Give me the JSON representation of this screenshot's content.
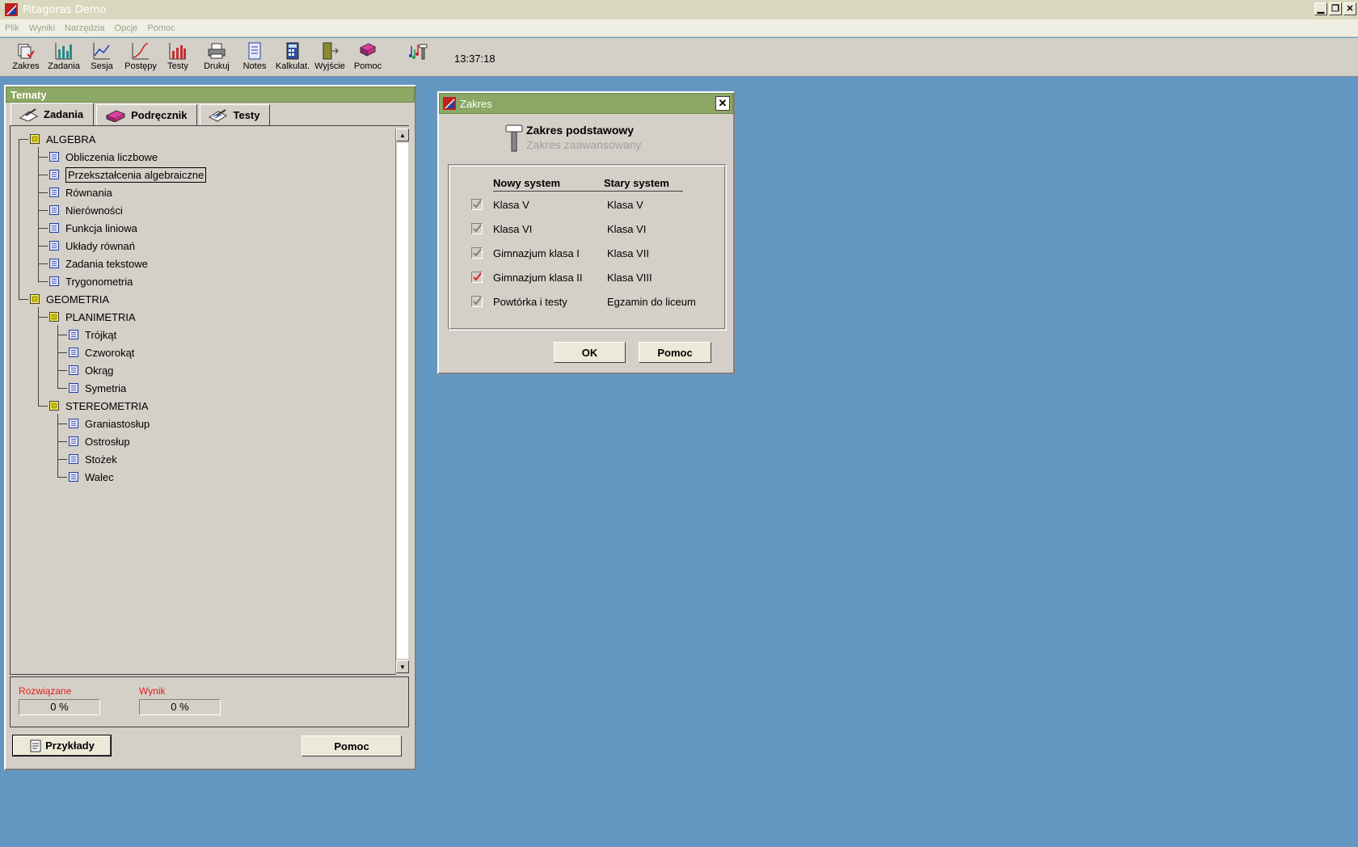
{
  "window": {
    "title": "Pitagoras Demo"
  },
  "menu": [
    "Plik",
    "Wyniki",
    "Narzędzia",
    "Opcje",
    "Pomoc"
  ],
  "toolbar": {
    "buttons": [
      {
        "label": "Zakres",
        "icon": "scope-icon"
      },
      {
        "label": "Zadania",
        "icon": "bar-chart-icon"
      },
      {
        "label": "Sesja",
        "icon": "line-chart-icon"
      },
      {
        "label": "Postępy",
        "icon": "progress-chart-icon"
      },
      {
        "label": "Testy",
        "icon": "test-chart-icon"
      },
      {
        "label": "Drukuj",
        "icon": "printer-icon"
      },
      {
        "label": "Notes",
        "icon": "notepad-icon"
      },
      {
        "label": "Kalkulat.",
        "icon": "calculator-icon"
      },
      {
        "label": "Wyjście",
        "icon": "exit-door-icon"
      },
      {
        "label": "Pomoc",
        "icon": "help-book-icon"
      }
    ],
    "clock": "13:37:18"
  },
  "panel": {
    "title": "Tematy",
    "tabs": [
      {
        "label": "Zadania",
        "icon": "pencil-paper-icon"
      },
      {
        "label": "Podręcznik",
        "icon": "book-icon"
      },
      {
        "label": "Testy",
        "icon": "test-sheet-icon"
      }
    ],
    "tree": {
      "algebra": "ALGEBRA",
      "algebra_items": [
        "Obliczenia liczbowe",
        "Przekształcenia algebraiczne",
        "Równania",
        "Nierówności",
        "Funkcja liniowa",
        "Układy równań",
        "Zadania tekstowe",
        "Trygonometria"
      ],
      "geometria": "GEOMETRIA",
      "planimetria": "PLANIMETRIA",
      "planimetria_items": [
        "Trójkąt",
        "Czworokąt",
        "Okrąg",
        "Symetria"
      ],
      "stereometria": "STEREOMETRIA",
      "stereometria_items": [
        "Graniastosłup",
        "Ostrosłup",
        "Stożek",
        "Walec"
      ]
    },
    "stats": {
      "solved_label": "Rozwiązane",
      "solved_value": "0 %",
      "score_label": "Wynik",
      "score_value": "0 %"
    },
    "examples_button": "Przykłady",
    "help_button": "Pomoc"
  },
  "dialog": {
    "title": "Zakres",
    "option_basic": "Zakres podstawowy",
    "option_advanced": "Zakres zaawansowany",
    "col_new": "Nowy system",
    "col_old": "Stary system",
    "rows": [
      {
        "new": "Klasa V",
        "old": "Klasa V",
        "checked": true,
        "highlight": false
      },
      {
        "new": "Klasa VI",
        "old": "Klasa VI",
        "checked": true,
        "highlight": false
      },
      {
        "new": "Gimnazjum klasa I",
        "old": "Klasa VII",
        "checked": true,
        "highlight": false
      },
      {
        "new": "Gimnazjum klasa II",
        "old": "Klasa VIII",
        "checked": true,
        "highlight": true
      },
      {
        "new": "Powtórka i testy",
        "old": "Egzamin do liceum",
        "checked": true,
        "highlight": false
      }
    ],
    "ok_button": "OK",
    "help_button": "Pomoc"
  },
  "colors": {
    "desktop": "#6496C2",
    "panel_header": "#8CA864",
    "stat_label": "#E02020",
    "check_red": "#E02020"
  }
}
